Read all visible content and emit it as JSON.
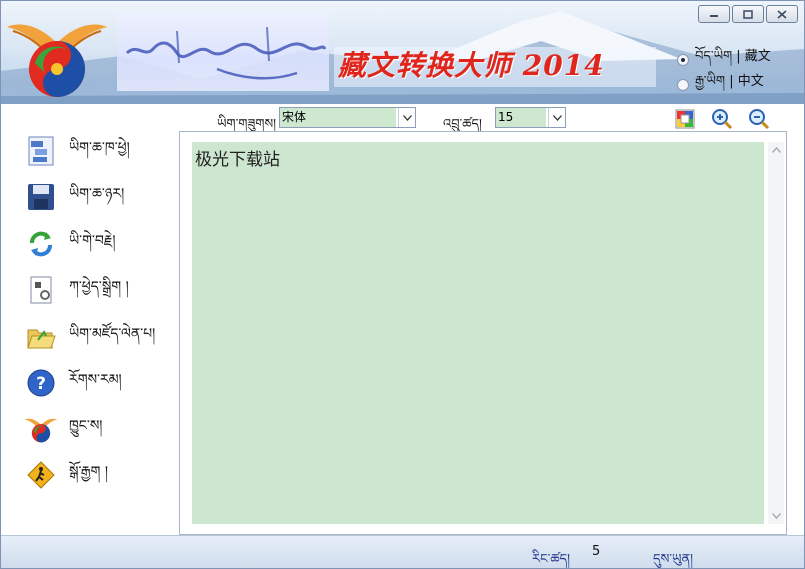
{
  "window": {
    "banner_title": "藏文转换大师 2014",
    "buttons": [
      "minimize",
      "maximize",
      "close"
    ]
  },
  "language": {
    "options": [
      {
        "label": "བོད་ཡིག | 藏文",
        "selected": true
      },
      {
        "label": "རྒྱ་ཡིག |  中文",
        "selected": false
      }
    ]
  },
  "toolbar": {
    "font_label": "ཡིག་གཟུགས།",
    "font_value": "宋体",
    "size_label": "འབྲུ་ཚད།",
    "size_value": "15",
    "icons": [
      "color-palette-icon",
      "zoom-in-icon",
      "zoom-out-icon"
    ]
  },
  "sidebar": {
    "items": [
      {
        "label": "ཡིག་ཆ་ཁ་ཕྱེ།",
        "icon": "open-file-icon"
      },
      {
        "label": "ཡིག་ཆ་ཉར།",
        "icon": "save-disk-icon"
      },
      {
        "label": "ཡི་གེ་བརྗེ།",
        "icon": "convert-arrows-icon"
      },
      {
        "label": "ཀ་ཕྱེད་སྒྲིག །",
        "icon": "document-gear-icon"
      },
      {
        "label": "ཡིག་མཛོད་ལེན་པ།",
        "icon": "open-folder-icon"
      },
      {
        "label": "རོགས་རམ།",
        "icon": "help-icon"
      },
      {
        "label": "ཁྱུང་ས།",
        "icon": "app-logo-icon"
      },
      {
        "label": "སྒོ་རྒྱག །",
        "icon": "exit-sign-icon"
      }
    ]
  },
  "editor": {
    "content": "极光下载站"
  },
  "statusbar": {
    "count_label": "རིང་ཚད།",
    "count_value": "5",
    "time_label": "དུས་ཡུན།"
  },
  "colors": {
    "editor_bg": "#cde6cf",
    "title_red": "#e0261c",
    "status_text": "#1a2f8a"
  }
}
